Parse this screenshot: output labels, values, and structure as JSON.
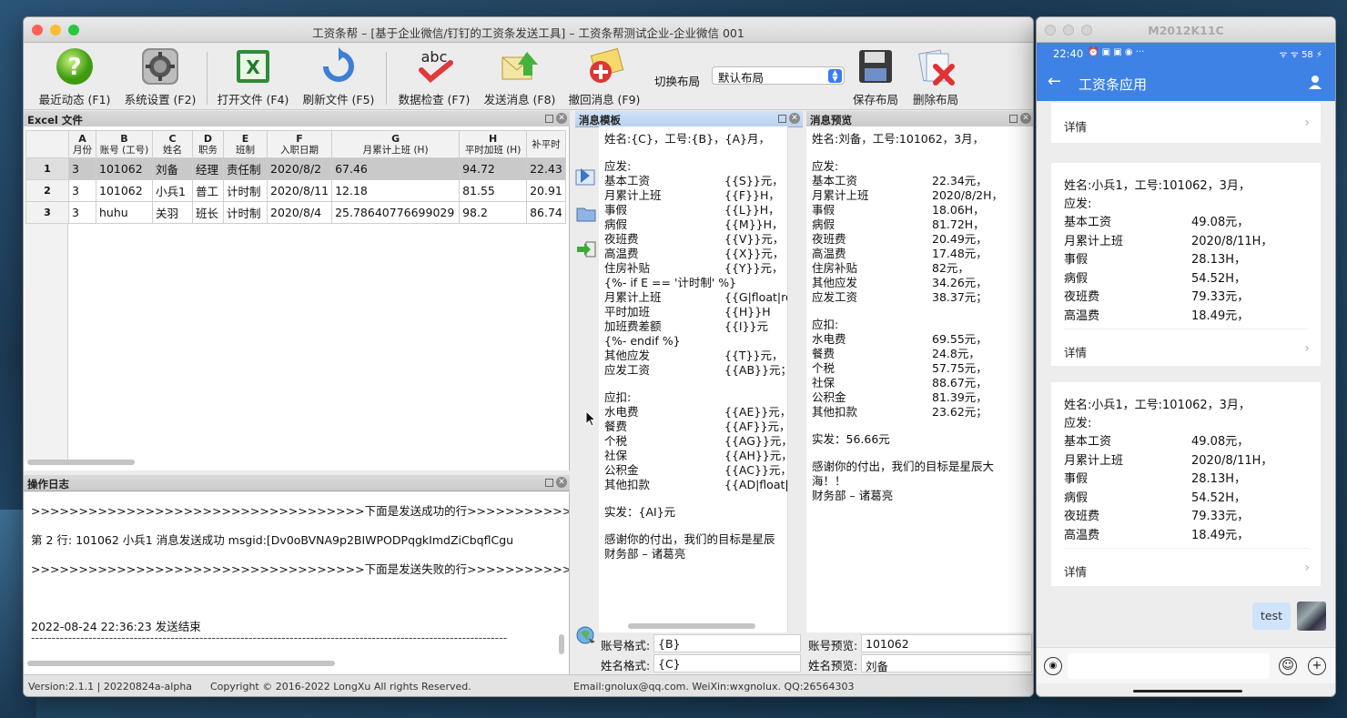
{
  "main_window": {
    "title": "工资条帮 – [基于企业微信/钉钉的工资条发送工具] – 工资条帮测试企业-企业微信 001",
    "toolbar": [
      {
        "label": "最近动态 (F1)",
        "icon": "help-question-icon"
      },
      {
        "label": "系统设置 (F2)",
        "icon": "settings-gear-icon"
      },
      {
        "label": "打开文件 (F4)",
        "icon": "excel-file-icon"
      },
      {
        "label": "刷新文件 (F5)",
        "icon": "refresh-icon"
      },
      {
        "label": "数据检查 (F7)",
        "icon": "spellcheck-abc-icon"
      },
      {
        "label": "发送消息 (F8)",
        "icon": "send-mail-icon"
      },
      {
        "label": "撤回消息 (F9)",
        "icon": "recall-mail-icon"
      }
    ],
    "layout": {
      "label": "切换布局",
      "selected": "默认布局",
      "save_label": "保存布局",
      "delete_label": "删除布局"
    },
    "excel_panel": {
      "title": "Excel 文件",
      "columns": [
        {
          "letter": "A",
          "name": "月份"
        },
        {
          "letter": "B",
          "name": "账号 (工号)"
        },
        {
          "letter": "C",
          "name": "姓名"
        },
        {
          "letter": "D",
          "name": "职务"
        },
        {
          "letter": "E",
          "name": "班制"
        },
        {
          "letter": "F",
          "name": "入职日期"
        },
        {
          "letter": "G",
          "name": "月累计上班 (H)"
        },
        {
          "letter": "H",
          "name": "平时加班 (H)"
        },
        {
          "letter": "",
          "name": "补平时"
        }
      ],
      "rows": [
        {
          "num": "1",
          "cells": [
            "3",
            "101062",
            "刘备",
            "经理",
            "责任制",
            "2020/8/2",
            "67.46",
            "94.72",
            "22.43"
          ]
        },
        {
          "num": "2",
          "cells": [
            "3",
            "101062",
            "小兵1",
            "普工",
            "计时制",
            "2020/8/11",
            "12.18",
            "81.55",
            "20.91"
          ]
        },
        {
          "num": "3",
          "cells": [
            "3",
            "huhu",
            "关羽",
            "班长",
            "计时制",
            "2020/8/4",
            "25.78640776699029",
            "98.2",
            "86.74"
          ]
        }
      ]
    },
    "log_panel": {
      "title": "操作日志",
      "lines": [
        ">>>>>>>>>>>>>>>>>>>>>>>>>>>>>>>>>>>下面是发送成功的行>>>>>>>>>>>>>>>>>>>>>>>>>>>>>>>>",
        "第    2  行:  101062     小兵1      消息发送成功 msgid:[Dv0oBVNA9p2BIWPODPqgkImdZiCbqflCgu",
        ">>>>>>>>>>>>>>>>>>>>>>>>>>>>>>>>>>>下面是发送失败的行>>>>>>>>>>>>>>>>>>>>>>>>>>>>>>>>",
        " 2022-08-24 22:36:23 发送结束",
        "--------------------------------------------------------------------------------------------------------------------"
      ]
    },
    "template_panel": {
      "title": "消息模板",
      "lines": [
        [
          "姓名:{C}，工号:{B}，{A}月，",
          ""
        ],
        [
          "",
          ""
        ],
        [
          "应发:",
          ""
        ],
        [
          "基本工资",
          "{{S}}元，"
        ],
        [
          "月累计上班",
          "{{F}}H，"
        ],
        [
          "事假",
          " {{L}}H，"
        ],
        [
          "病假",
          "{{M}}H，"
        ],
        [
          "夜班费",
          "{{V}}元，"
        ],
        [
          "高温费",
          "{{X}}元，"
        ],
        [
          "住房补贴",
          "{{Y}}元，"
        ],
        [
          "{%- if E == '计时制' %}",
          ""
        ],
        [
          "月累计上班",
          "{{G|float|rou"
        ],
        [
          "平时加班",
          "{{H}}H"
        ],
        [
          "加班费差额",
          "{{I}}元"
        ],
        [
          "{%- endif %}",
          ""
        ],
        [
          "其他应发",
          "{{T}}元，"
        ],
        [
          "应发工资",
          "{{AB}}元；"
        ],
        [
          "",
          ""
        ],
        [
          "应扣:",
          ""
        ],
        [
          "水电费",
          "{{AE}}元，"
        ],
        [
          "餐费",
          "{{AF}}元，"
        ],
        [
          "个税",
          "{{AG}}元，"
        ],
        [
          "社保",
          "{{AH}}元，"
        ],
        [
          "公积金",
          "{{AC}}元，"
        ],
        [
          "其他扣款",
          "{{AD|float|r"
        ],
        [
          "",
          ""
        ],
        [
          "实发：{AI}元",
          ""
        ],
        [
          "",
          ""
        ],
        [
          "感谢你的付出，我们的目标是星辰",
          ""
        ],
        [
          "财务部 – 诸葛亮",
          ""
        ]
      ],
      "account_format_label": "账号格式:",
      "account_format_value": "{B}",
      "name_format_label": "姓名格式:",
      "name_format_value": "{C}"
    },
    "preview_panel": {
      "title": "消息预览",
      "lines": [
        [
          "姓名:刘备，工号:101062，3月，",
          ""
        ],
        [
          "",
          ""
        ],
        [
          "应发:",
          ""
        ],
        [
          "基本工资",
          "22.34元，"
        ],
        [
          "月累计上班",
          "2020/8/2H，"
        ],
        [
          "事假",
          " 18.06H，"
        ],
        [
          "病假",
          "81.72H，"
        ],
        [
          "夜班费",
          "20.49元，"
        ],
        [
          "高温费",
          "17.48元，"
        ],
        [
          "住房补贴",
          "82元，"
        ],
        [
          "其他应发",
          "34.26元，"
        ],
        [
          "应发工资",
          "38.37元；"
        ],
        [
          "",
          ""
        ],
        [
          "应扣:",
          ""
        ],
        [
          "水电费",
          "69.55元，"
        ],
        [
          "餐费",
          "24.8元，"
        ],
        [
          "个税",
          "57.75元，"
        ],
        [
          "社保",
          "88.67元，"
        ],
        [
          "公积金",
          "81.39元，"
        ],
        [
          "其他扣款",
          "23.62元；"
        ],
        [
          "",
          ""
        ],
        [
          "实发：56.66元",
          ""
        ],
        [
          "",
          ""
        ],
        [
          "感谢你的付出，我们的目标是星辰大",
          ""
        ],
        [
          "海！！",
          ""
        ],
        [
          "财务部 – 诸葛亮",
          ""
        ]
      ],
      "account_preview_label": "账号预览:",
      "account_preview_value": "101062",
      "name_preview_label": "姓名预览:",
      "name_preview_value": "刘备"
    },
    "statusbar": {
      "version": "Version:2.1.1 | 20220824a-alpha",
      "copyright": "Copyright © 2016-2022 LongXu All rights Reserved.",
      "contact": "Email:gnolux@qq.com.  WeiXin:wxgnolux. QQ:26564303"
    }
  },
  "phone_window": {
    "title": "M2012K11C",
    "status_time": "22:40",
    "status_icons": "⏰ ▣ ▣ ◉ ···",
    "status_right": "ᯤ ᯤ 58 ⚡",
    "app_title": "工资条应用",
    "detail_label": "详情",
    "cards": [
      {
        "header": "姓名:小兵1，工号:101062，3月，",
        "section": "应发:",
        "items": [
          [
            "基本工资",
            "49.08元，"
          ],
          [
            "月累计上班",
            "2020/8/11H，"
          ],
          [
            "事假",
            "28.13H，"
          ],
          [
            "病假",
            " 54.52H，"
          ],
          [
            "夜班费",
            "79.33元，"
          ],
          [
            "高温费",
            "18.49元，"
          ]
        ]
      },
      {
        "header": "姓名:小兵1，工号:101062，3月，",
        "section": "应发:",
        "items": [
          [
            "基本工资",
            "49.08元，"
          ],
          [
            "月累计上班",
            "2020/8/11H，"
          ],
          [
            "事假",
            "   28.13H，"
          ],
          [
            "病假",
            " 54.52H，"
          ],
          [
            "夜班费",
            "79.33元，"
          ],
          [
            "高温费",
            "18.49元，"
          ]
        ]
      }
    ],
    "chat_message": "test"
  },
  "colors": {
    "accent_blue": "#3e82e6",
    "selected_row": "#c9c9c9",
    "close_red": "#ff5f57",
    "min_yellow": "#febc2e",
    "max_green": "#28c840"
  }
}
